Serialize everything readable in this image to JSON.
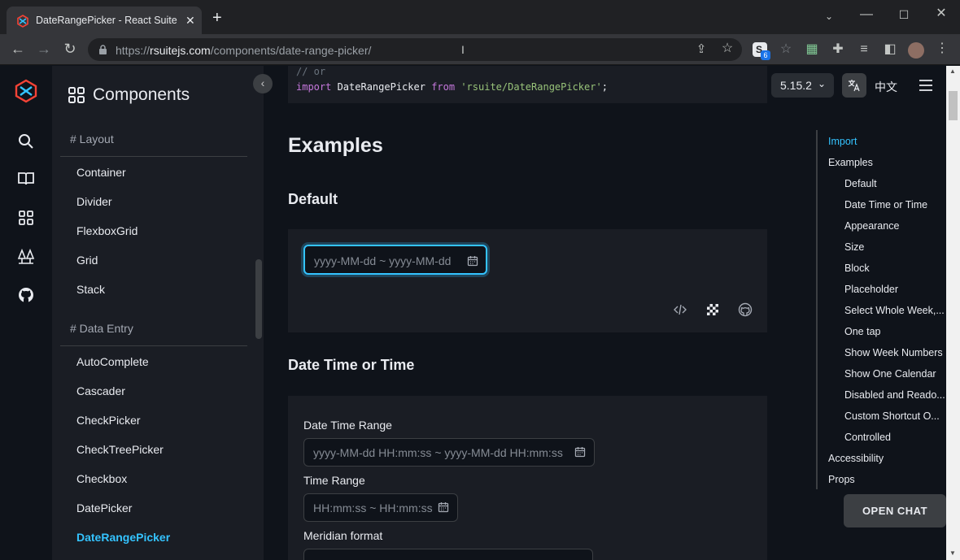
{
  "browser": {
    "tab_title": "DateRangePicker - React Suite",
    "url_host": "rsuitejs.com",
    "url_path": "/components/date-range-picker/",
    "url_prefix": "https://",
    "extension_badge": "6"
  },
  "sidebar": {
    "heading": "Components",
    "groups": [
      {
        "title": "# Layout",
        "items": [
          "Container",
          "Divider",
          "FlexboxGrid",
          "Grid",
          "Stack"
        ]
      },
      {
        "title": "# Data Entry",
        "items": [
          "AutoComplete",
          "Cascader",
          "CheckPicker",
          "CheckTreePicker",
          "Checkbox",
          "DatePicker",
          "DateRangePicker"
        ]
      }
    ],
    "active_item": "DateRangePicker"
  },
  "code": {
    "comment": "// or",
    "import_kw": "import",
    "ident": " DateRangePicker ",
    "from_kw": "from",
    "module": " 'rsuite/DateRangePicker'",
    "semi": ";"
  },
  "main": {
    "examples_title": "Examples",
    "default_title": "Default",
    "default_placeholder": "yyyy-MM-dd ~ yyyy-MM-dd",
    "datetime_title": "Date Time or Time",
    "datetime_label": "Date Time Range",
    "datetime_placeholder": "yyyy-MM-dd HH:mm:ss ~ yyyy-MM-dd HH:mm:ss",
    "time_label": "Time Range",
    "time_placeholder": "HH:mm:ss ~ HH:mm:ss",
    "meridian_label": "Meridian format"
  },
  "header": {
    "version": "5.15.2",
    "language": "中文"
  },
  "toc": {
    "items": [
      {
        "label": "Import",
        "level": 1,
        "active": true
      },
      {
        "label": "Examples",
        "level": 1
      },
      {
        "label": "Default",
        "level": 2
      },
      {
        "label": "Date Time or Time",
        "level": 2
      },
      {
        "label": "Appearance",
        "level": 2
      },
      {
        "label": "Size",
        "level": 2
      },
      {
        "label": "Block",
        "level": 2
      },
      {
        "label": "Placeholder",
        "level": 2
      },
      {
        "label": "Select Whole Week,...",
        "level": 2
      },
      {
        "label": "One tap",
        "level": 2
      },
      {
        "label": "Show Week Numbers",
        "level": 2
      },
      {
        "label": "Show One Calendar",
        "level": 2
      },
      {
        "label": "Disabled and Reado...",
        "level": 2
      },
      {
        "label": "Custom Shortcut O...",
        "level": 2
      },
      {
        "label": "Controlled",
        "level": 2
      },
      {
        "label": "Accessibility",
        "level": 1
      },
      {
        "label": "Props",
        "level": 1
      }
    ]
  },
  "chat_button": "OPEN CHAT",
  "colors": {
    "accent": "#34c3ff",
    "page_bg": "#0f131a",
    "panel_bg": "#1a1d24"
  }
}
